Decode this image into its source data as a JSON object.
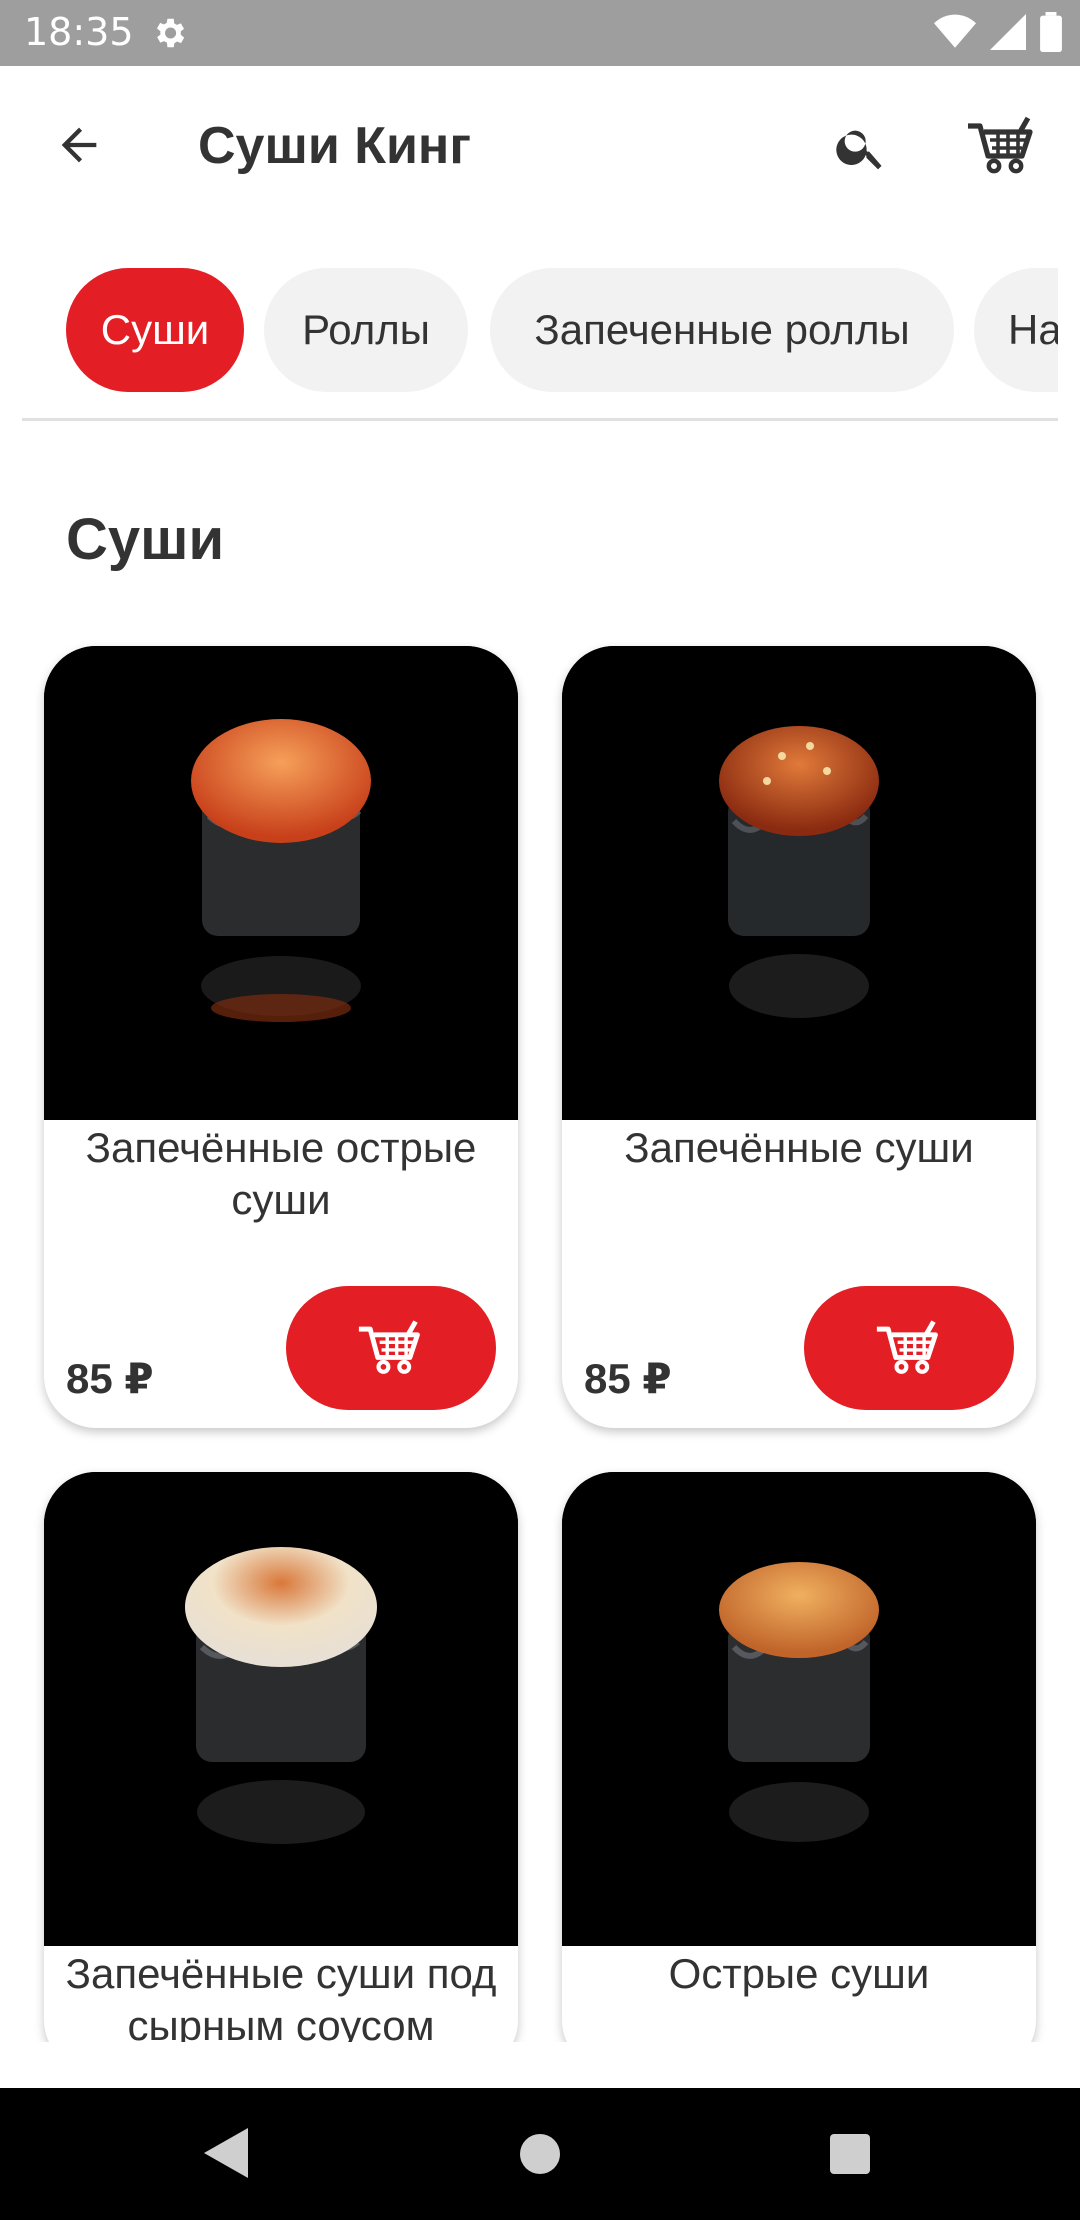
{
  "status_bar": {
    "time": "18:35"
  },
  "app_bar": {
    "title": "Суши Кинг"
  },
  "categories": [
    {
      "label": "Суши",
      "active": true
    },
    {
      "label": "Роллы",
      "active": false
    },
    {
      "label": "Запеченные роллы",
      "active": false
    },
    {
      "label": "На",
      "active": false
    }
  ],
  "section": {
    "title": "Суши"
  },
  "products": [
    {
      "name": "Запечённые острые суши",
      "price": "85 ₽"
    },
    {
      "name": "Запечённые суши",
      "price": "85 ₽"
    },
    {
      "name": "Запечённые суши под сырным соусом",
      "price": ""
    },
    {
      "name": "Острые суши",
      "price": ""
    }
  ],
  "colors": {
    "accent": "#e31e24",
    "chip_bg": "#f2f2f2",
    "status_bar": "#9e9e9e"
  },
  "icons": [
    "back-arrow-icon",
    "search-icon",
    "cart-icon",
    "settings-gear-icon",
    "wifi-icon",
    "signal-icon",
    "battery-icon"
  ]
}
